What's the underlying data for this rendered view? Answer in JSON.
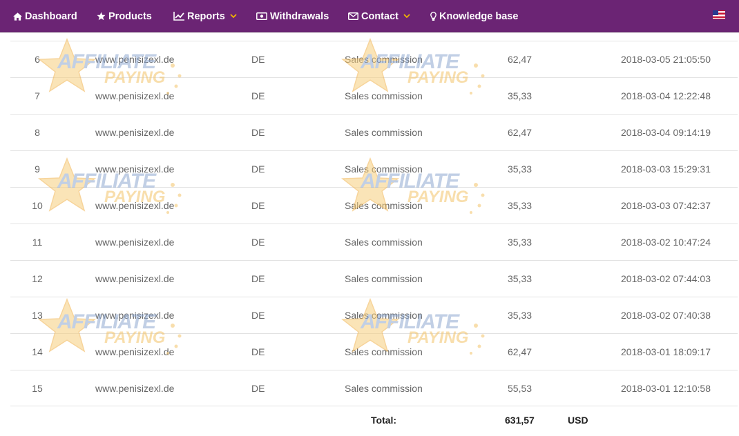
{
  "nav": {
    "dashboard": "Dashboard",
    "products": "Products",
    "reports": "Reports",
    "withdrawals": "Withdrawals",
    "contact": "Contact",
    "knowledge_base": "Knowledge base"
  },
  "table": {
    "rows": [
      {
        "num": "6",
        "site": "www.penisizexl.de",
        "country": "DE",
        "type": "Sales commission",
        "amount": "62,47",
        "date": "2018-03-05 21:05:50"
      },
      {
        "num": "7",
        "site": "www.penisizexl.de",
        "country": "DE",
        "type": "Sales commission",
        "amount": "35,33",
        "date": "2018-03-04 12:22:48"
      },
      {
        "num": "8",
        "site": "www.penisizexl.de",
        "country": "DE",
        "type": "Sales commission",
        "amount": "62,47",
        "date": "2018-03-04 09:14:19"
      },
      {
        "num": "9",
        "site": "www.penisizexl.de",
        "country": "DE",
        "type": "Sales commission",
        "amount": "35,33",
        "date": "2018-03-03 15:29:31"
      },
      {
        "num": "10",
        "site": "www.penisizexl.de",
        "country": "DE",
        "type": "Sales commission",
        "amount": "35,33",
        "date": "2018-03-03 07:42:37"
      },
      {
        "num": "11",
        "site": "www.penisizexl.de",
        "country": "DE",
        "type": "Sales commission",
        "amount": "35,33",
        "date": "2018-03-02 10:47:24"
      },
      {
        "num": "12",
        "site": "www.penisizexl.de",
        "country": "DE",
        "type": "Sales commission",
        "amount": "35,33",
        "date": "2018-03-02 07:44:03"
      },
      {
        "num": "13",
        "site": "www.penisizexl.de",
        "country": "DE",
        "type": "Sales commission",
        "amount": "35,33",
        "date": "2018-03-02 07:40:38"
      },
      {
        "num": "14",
        "site": "www.penisizexl.de",
        "country": "DE",
        "type": "Sales commission",
        "amount": "62,47",
        "date": "2018-03-01 18:09:17"
      },
      {
        "num": "15",
        "site": "www.penisizexl.de",
        "country": "DE",
        "type": "Sales commission",
        "amount": "55,53",
        "date": "2018-03-01 12:10:58"
      }
    ],
    "total": {
      "label": "Total:",
      "value": "631,57",
      "currency": "USD"
    }
  },
  "watermark": {
    "line1": "AFFILIATE",
    "line2": "PAYING"
  },
  "colors": {
    "nav_bg": "#6b2474",
    "nav_text": "#ffffff",
    "caret": "#f0b400",
    "row_text": "#666666",
    "divider": "#e2e2e2"
  },
  "icons": {
    "dashboard": "home-icon",
    "products": "star-icon",
    "reports": "line-chart-icon",
    "withdrawals": "banknote-icon",
    "contact": "envelope-icon",
    "knowledge_base": "lightbulb-icon",
    "language": "us-flag-icon"
  }
}
